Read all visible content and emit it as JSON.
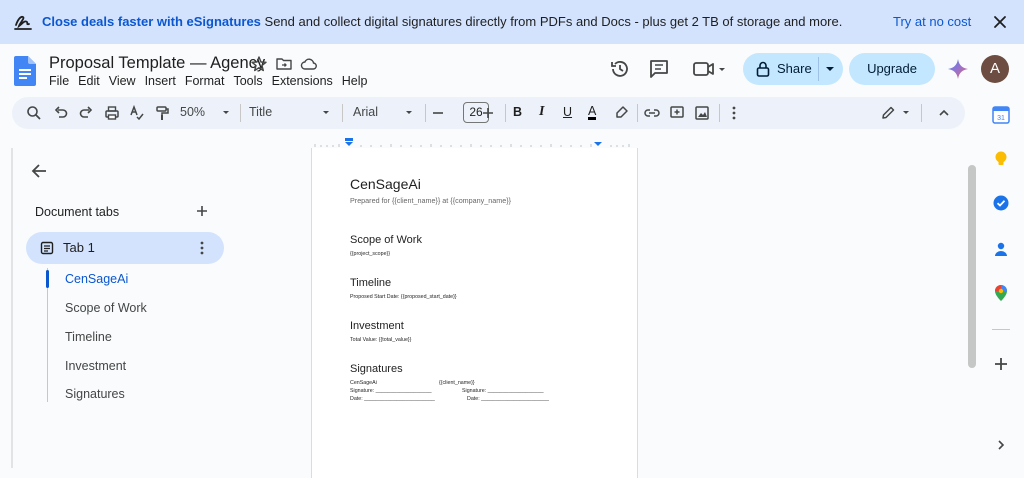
{
  "banner": {
    "headline": "Close deals faster with eSignatures",
    "body": "Send and collect digital signatures directly from PDFs and Docs - plus get 2 TB of storage and more.",
    "cta": "Try at no cost"
  },
  "header": {
    "doc_title": "Proposal Template — Agency",
    "menus": [
      "File",
      "Edit",
      "View",
      "Insert",
      "Format",
      "Tools",
      "Extensions",
      "Help"
    ],
    "share_label": "Share",
    "upgrade_label": "Upgrade",
    "avatar_letter": "A"
  },
  "toolbar": {
    "zoom": "50%",
    "style": "Title",
    "font": "Arial",
    "font_size": "26",
    "bold": "B",
    "italic": "I",
    "underline": "U",
    "text_color": "A"
  },
  "sidebar": {
    "title": "Document tabs",
    "tab_label": "Tab 1",
    "outline": [
      "CenSageAi",
      "Scope of Work",
      "Timeline",
      "Investment",
      "Signatures"
    ]
  },
  "document": {
    "company": "CenSageAi",
    "prepared_for": "Prepared for {{client_name}} at {{company_name}}",
    "scope_heading": "Scope of Work",
    "scope_body": "{{project_scope}}",
    "timeline_heading": "Timeline",
    "timeline_body": "Proposed Start Date: {{proposed_start_date}}",
    "investment_heading": "Investment",
    "investment_body": "Total Value: {{total_value}}",
    "signatures_heading": "Signatures",
    "sig_left_name": "CenSageAi",
    "sig_right_name": "{{client_name}}",
    "sig_line_label": "Signature: ___________________",
    "date_line_label": "Date: ________________________",
    "sig_line_label_right": "Signature: ___________________",
    "date_line_label_right": "Date: _______________________"
  },
  "colors": {
    "banner_bg": "#d3e3fd",
    "accent": "#0b57d0",
    "share_bg": "#c2e7ff",
    "toolbar_bg": "#edf2fa"
  }
}
